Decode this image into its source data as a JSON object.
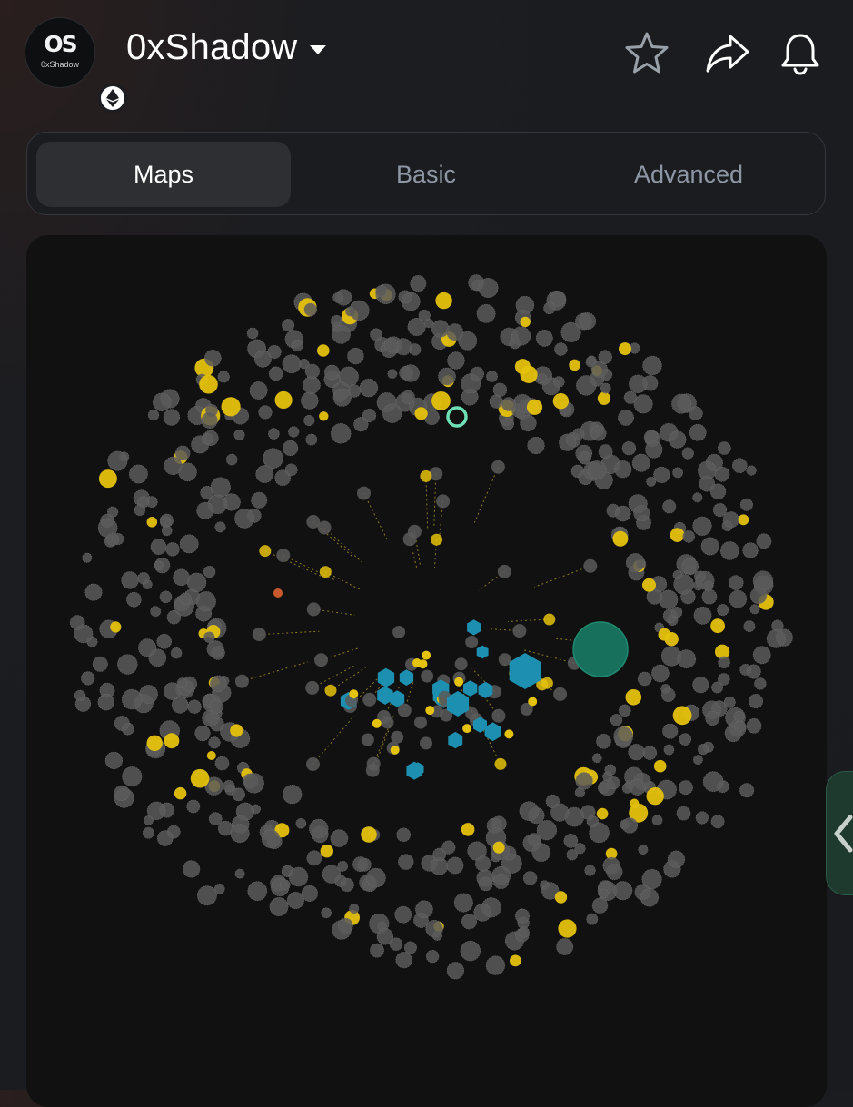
{
  "header": {
    "avatar_monogram": "OS",
    "avatar_text": "0xShadow",
    "chain_badge_icon": "ethereum-icon",
    "title": "0xShadow",
    "icons": [
      "star-icon",
      "share-icon",
      "bell-icon"
    ]
  },
  "tabs": [
    {
      "label": "Maps",
      "active": true
    },
    {
      "label": "Basic",
      "active": false
    },
    {
      "label": "Advanced",
      "active": false
    }
  ],
  "map": {
    "node_colors": {
      "gray": "#5a5a5a",
      "yellow": "#e5c20c",
      "blue": "#1d8fb0",
      "green_large": "#16705c",
      "highlight_ring": "#6fe0b6",
      "orange": "#c65a2c"
    },
    "highlight_icon": "selected-ring-icon",
    "side_handle_icon": "chevron-left-icon"
  }
}
